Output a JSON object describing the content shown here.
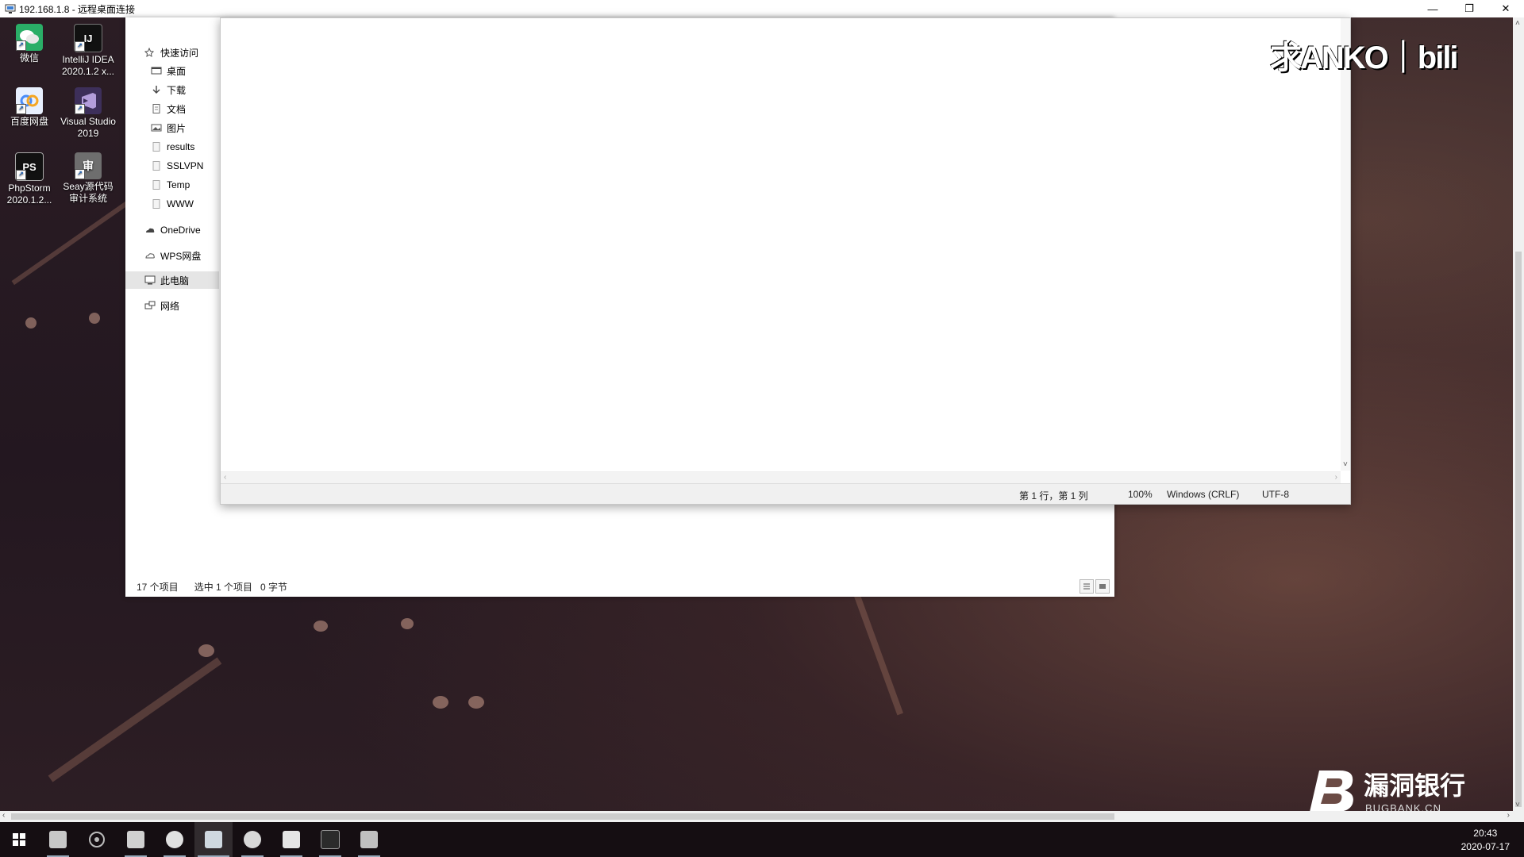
{
  "window": {
    "title": "192.168.1.8 - 远程桌面连接",
    "controls": {
      "minimize": "—",
      "restore": "❐",
      "close": "✕"
    }
  },
  "desktop_icons": [
    {
      "label": "微信",
      "icon": "wechat-icon",
      "color": "#2aae67"
    },
    {
      "label": "IntelliJ IDEA 2020.1.2 x...",
      "icon": "intellij-icon",
      "color": "#000000"
    },
    {
      "label": "百度网盘",
      "icon": "baidu-netdisk-icon",
      "color": "#4a8cf7"
    },
    {
      "label": "Visual Studio 2019",
      "icon": "visual-studio-icon",
      "color": "#7a5fb0"
    },
    {
      "label": "PhpStorm 2020.1.2...",
      "icon": "phpstorm-icon",
      "color": "#000000"
    },
    {
      "label": "Seay源代码 审计系统",
      "icon": "seay-icon",
      "color": "#888888"
    }
  ],
  "explorer": {
    "nav": [
      {
        "label": "快速访问",
        "icon": "star-icon"
      },
      {
        "label": "桌面",
        "icon": "desktop-folder-icon"
      },
      {
        "label": "下载",
        "icon": "download-icon"
      },
      {
        "label": "文档",
        "icon": "document-icon"
      },
      {
        "label": "图片",
        "icon": "picture-icon"
      },
      {
        "label": "results",
        "icon": "folder-icon"
      },
      {
        "label": "SSLVPN",
        "icon": "folder-icon"
      },
      {
        "label": "Temp",
        "icon": "folder-icon"
      },
      {
        "label": "WWW",
        "icon": "folder-icon"
      },
      {
        "label": "OneDrive",
        "icon": "onedrive-icon"
      },
      {
        "label": "WPS网盘",
        "icon": "cloud-icon"
      },
      {
        "label": "此电脑",
        "icon": "computer-icon"
      },
      {
        "label": "网络",
        "icon": "network-icon"
      }
    ],
    "selected_nav": "此电脑",
    "status": {
      "item_count": "17 个项目",
      "selection": "选中 1 个项目",
      "size": "0 字节"
    }
  },
  "notepad": {
    "content": "",
    "status": {
      "position": "第 1 行，第 1 列",
      "zoom": "100%",
      "line_ending": "Windows (CRLF)",
      "encoding": "UTF-8"
    }
  },
  "taskbar": {
    "apps": [
      {
        "icon": "windows-start-icon",
        "color": "#ffffff"
      },
      {
        "icon": "app-icon-1",
        "color": "#c8c8c8"
      },
      {
        "icon": "chrome-like-icon",
        "color": "#bbbbbb"
      },
      {
        "icon": "app-icon-3",
        "color": "#d0d0d0"
      },
      {
        "icon": "app-icon-4",
        "color": "#e0e0e0"
      },
      {
        "icon": "remote-desktop-icon",
        "color": "#cfd8e0"
      },
      {
        "icon": "app-icon-6",
        "color": "#d8d8d8"
      },
      {
        "icon": "file-explorer-icon",
        "color": "#e5e5e5"
      },
      {
        "icon": "terminal-icon",
        "color": "#9a9a9a"
      },
      {
        "icon": "app-icon-9",
        "color": "#c0c0c0"
      }
    ],
    "time": "20:43",
    "date": "2020-07-17"
  },
  "watermarks": {
    "top": "求ANKO｜bili",
    "bottom_name": "漏洞银行",
    "bottom_url": "BUGBANK.CN"
  }
}
